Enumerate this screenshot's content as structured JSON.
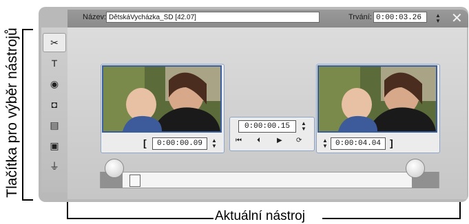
{
  "annotations": {
    "tool_buttons_label": "Tlačítka pro výběr nástrojů",
    "current_tool_label": "Aktuální nástroj"
  },
  "titlebar": {
    "name_label": "Název:",
    "name_value": "DětskáVycházka_SD [42.07]",
    "duration_label": "Trvání:",
    "duration_value": "0:00:03.26"
  },
  "toolbar": {
    "tools": [
      {
        "icon": "video-trim-icon",
        "glyph": "✂"
      },
      {
        "icon": "title-text-icon",
        "glyph": "T"
      },
      {
        "icon": "cd-dvd-icon",
        "glyph": "◉"
      },
      {
        "icon": "camera-icon",
        "glyph": "◘"
      },
      {
        "icon": "clapper-icon",
        "glyph": "▤"
      },
      {
        "icon": "frame-icon",
        "glyph": "▣"
      },
      {
        "icon": "plug-icon",
        "glyph": "⏚"
      }
    ],
    "active_index": 0
  },
  "editor": {
    "in_timecode": "0:00:00.09",
    "current_timecode": "0:00:00.15",
    "out_timecode": "0:00:04.04",
    "in_bracket": "[",
    "out_bracket": "]",
    "transport_skip_start": "⏮",
    "transport_step_back": "⏴",
    "transport_play": "▶",
    "transport_loop": "⟳",
    "spin_up": "▲",
    "spin_down": "▼",
    "close": "✕"
  },
  "colors": {
    "accent": "#3b5f9e",
    "window": "#b9b9b9",
    "titlebar": "#8f8f8f"
  }
}
